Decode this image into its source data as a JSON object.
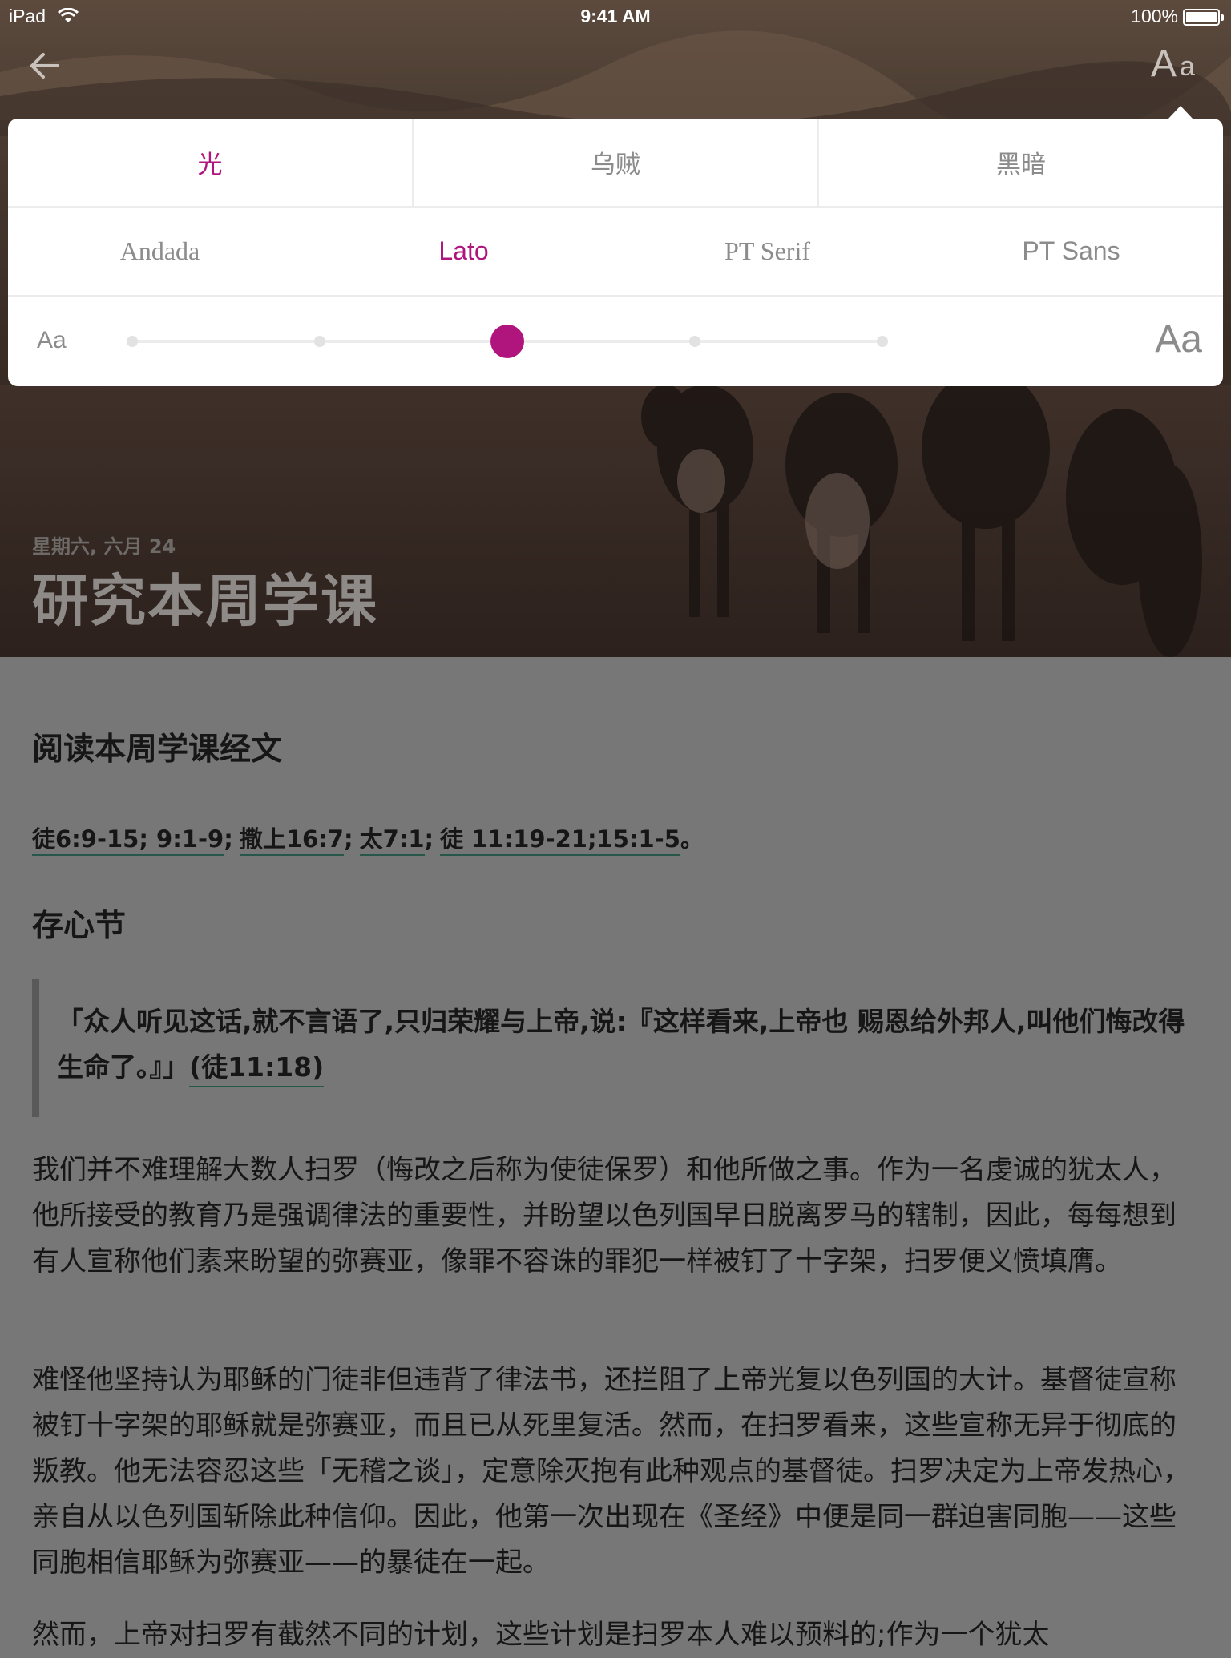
{
  "status_bar": {
    "device": "iPad",
    "time": "9:41 AM",
    "battery": "100%",
    "battery_level": 1.0
  },
  "nav": {
    "back_icon": "arrow-left-icon",
    "font_settings_big": "A",
    "font_settings_small": "a"
  },
  "popover": {
    "themes": [
      {
        "label": "光",
        "active": true
      },
      {
        "label": "乌贼",
        "active": false
      },
      {
        "label": "黑暗",
        "active": false
      }
    ],
    "fonts": [
      {
        "label": "Andada",
        "active": false
      },
      {
        "label": "Lato",
        "active": true
      },
      {
        "label": "PT Serif",
        "active": false
      },
      {
        "label": "PT Sans",
        "active": false
      }
    ],
    "size_small_label": "Aa",
    "size_large_label": "Aa",
    "size_steps": 5,
    "size_selected_index": 2,
    "accent_color": "#b0157e"
  },
  "hero": {
    "date": "星期六, 六月 24",
    "title": "研究本周学课"
  },
  "article": {
    "reading_heading": "阅读本周学课经文",
    "refs": [
      "徒6:9-15; 9:1-9",
      "撒上16:7",
      "太7:1",
      "徒 11:19-21;15:1-5"
    ],
    "refs_end": "。",
    "memory_heading": "存心节",
    "memory_text": "「众人听见这话,就不言语了,只归荣耀与上帝,说:『这样看来,上帝也 赐恩给外邦人,叫他们悔改得生命了。』」",
    "memory_ref": "(徒11:18)",
    "paragraphs": [
      "我们并不难理解大数人扫罗（悔改之后称为使徒保罗）和他所做之事。作为一名虔诚的犹太人，他所接受的教育乃是强调律法的重要性，并盼望以色列国早日脱离罗马的辖制，因此，每每想到有人宣称他们素来盼望的弥赛亚，像罪不容诛的罪犯一样被钉了十字架，扫罗便义愤填膺。",
      "难怪他坚持认为耶稣的门徒非但违背了律法书，还拦阻了上帝光复以色列国的大计。基督徒宣称被钉十字架的耶稣就是弥赛亚，而且已从死里复活。然而，在扫罗看来，这些宣称无异于彻底的叛教。他无法容忍这些「无稽之谈」，定意除灭抱有此种观点的基督徒。扫罗决定为上帝发热心，亲自从以色列国斩除此种信仰。因此，他第一次出现在《圣经》中便是同一群迫害同胞——这些同胞相信耶稣为弥赛亚——的暴徒在一起。",
      "然而，上帝对扫罗有截然不同的计划，这些计划是扫罗本人难以预料的;作为一个犹太"
    ],
    "link_underline_color": "#27574a"
  }
}
